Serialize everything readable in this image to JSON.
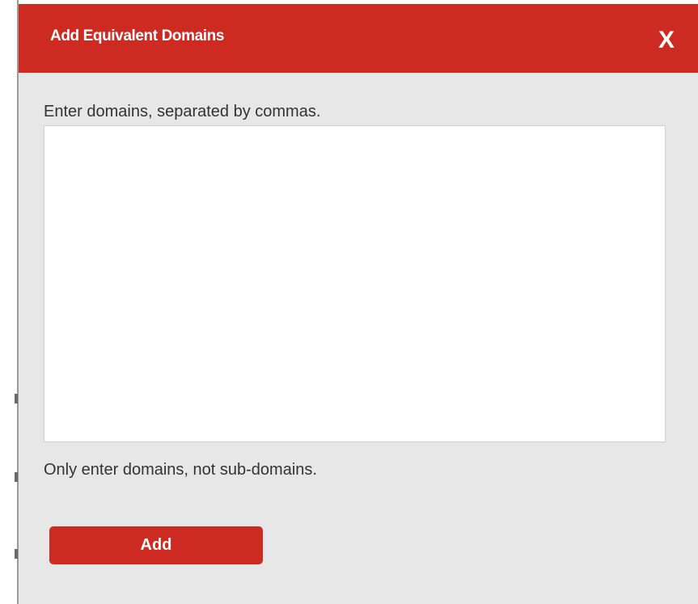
{
  "dialog": {
    "title": "Add Equivalent Domains",
    "close_label": "X",
    "instruction": "Enter domains, separated by commas.",
    "textarea_value": "",
    "hint": "Only enter domains, not sub-domains.",
    "add_button_label": "Add"
  },
  "colors": {
    "header": "#cd2a22",
    "dialog_background": "#e7e7e7",
    "button": "#cd2a22"
  }
}
